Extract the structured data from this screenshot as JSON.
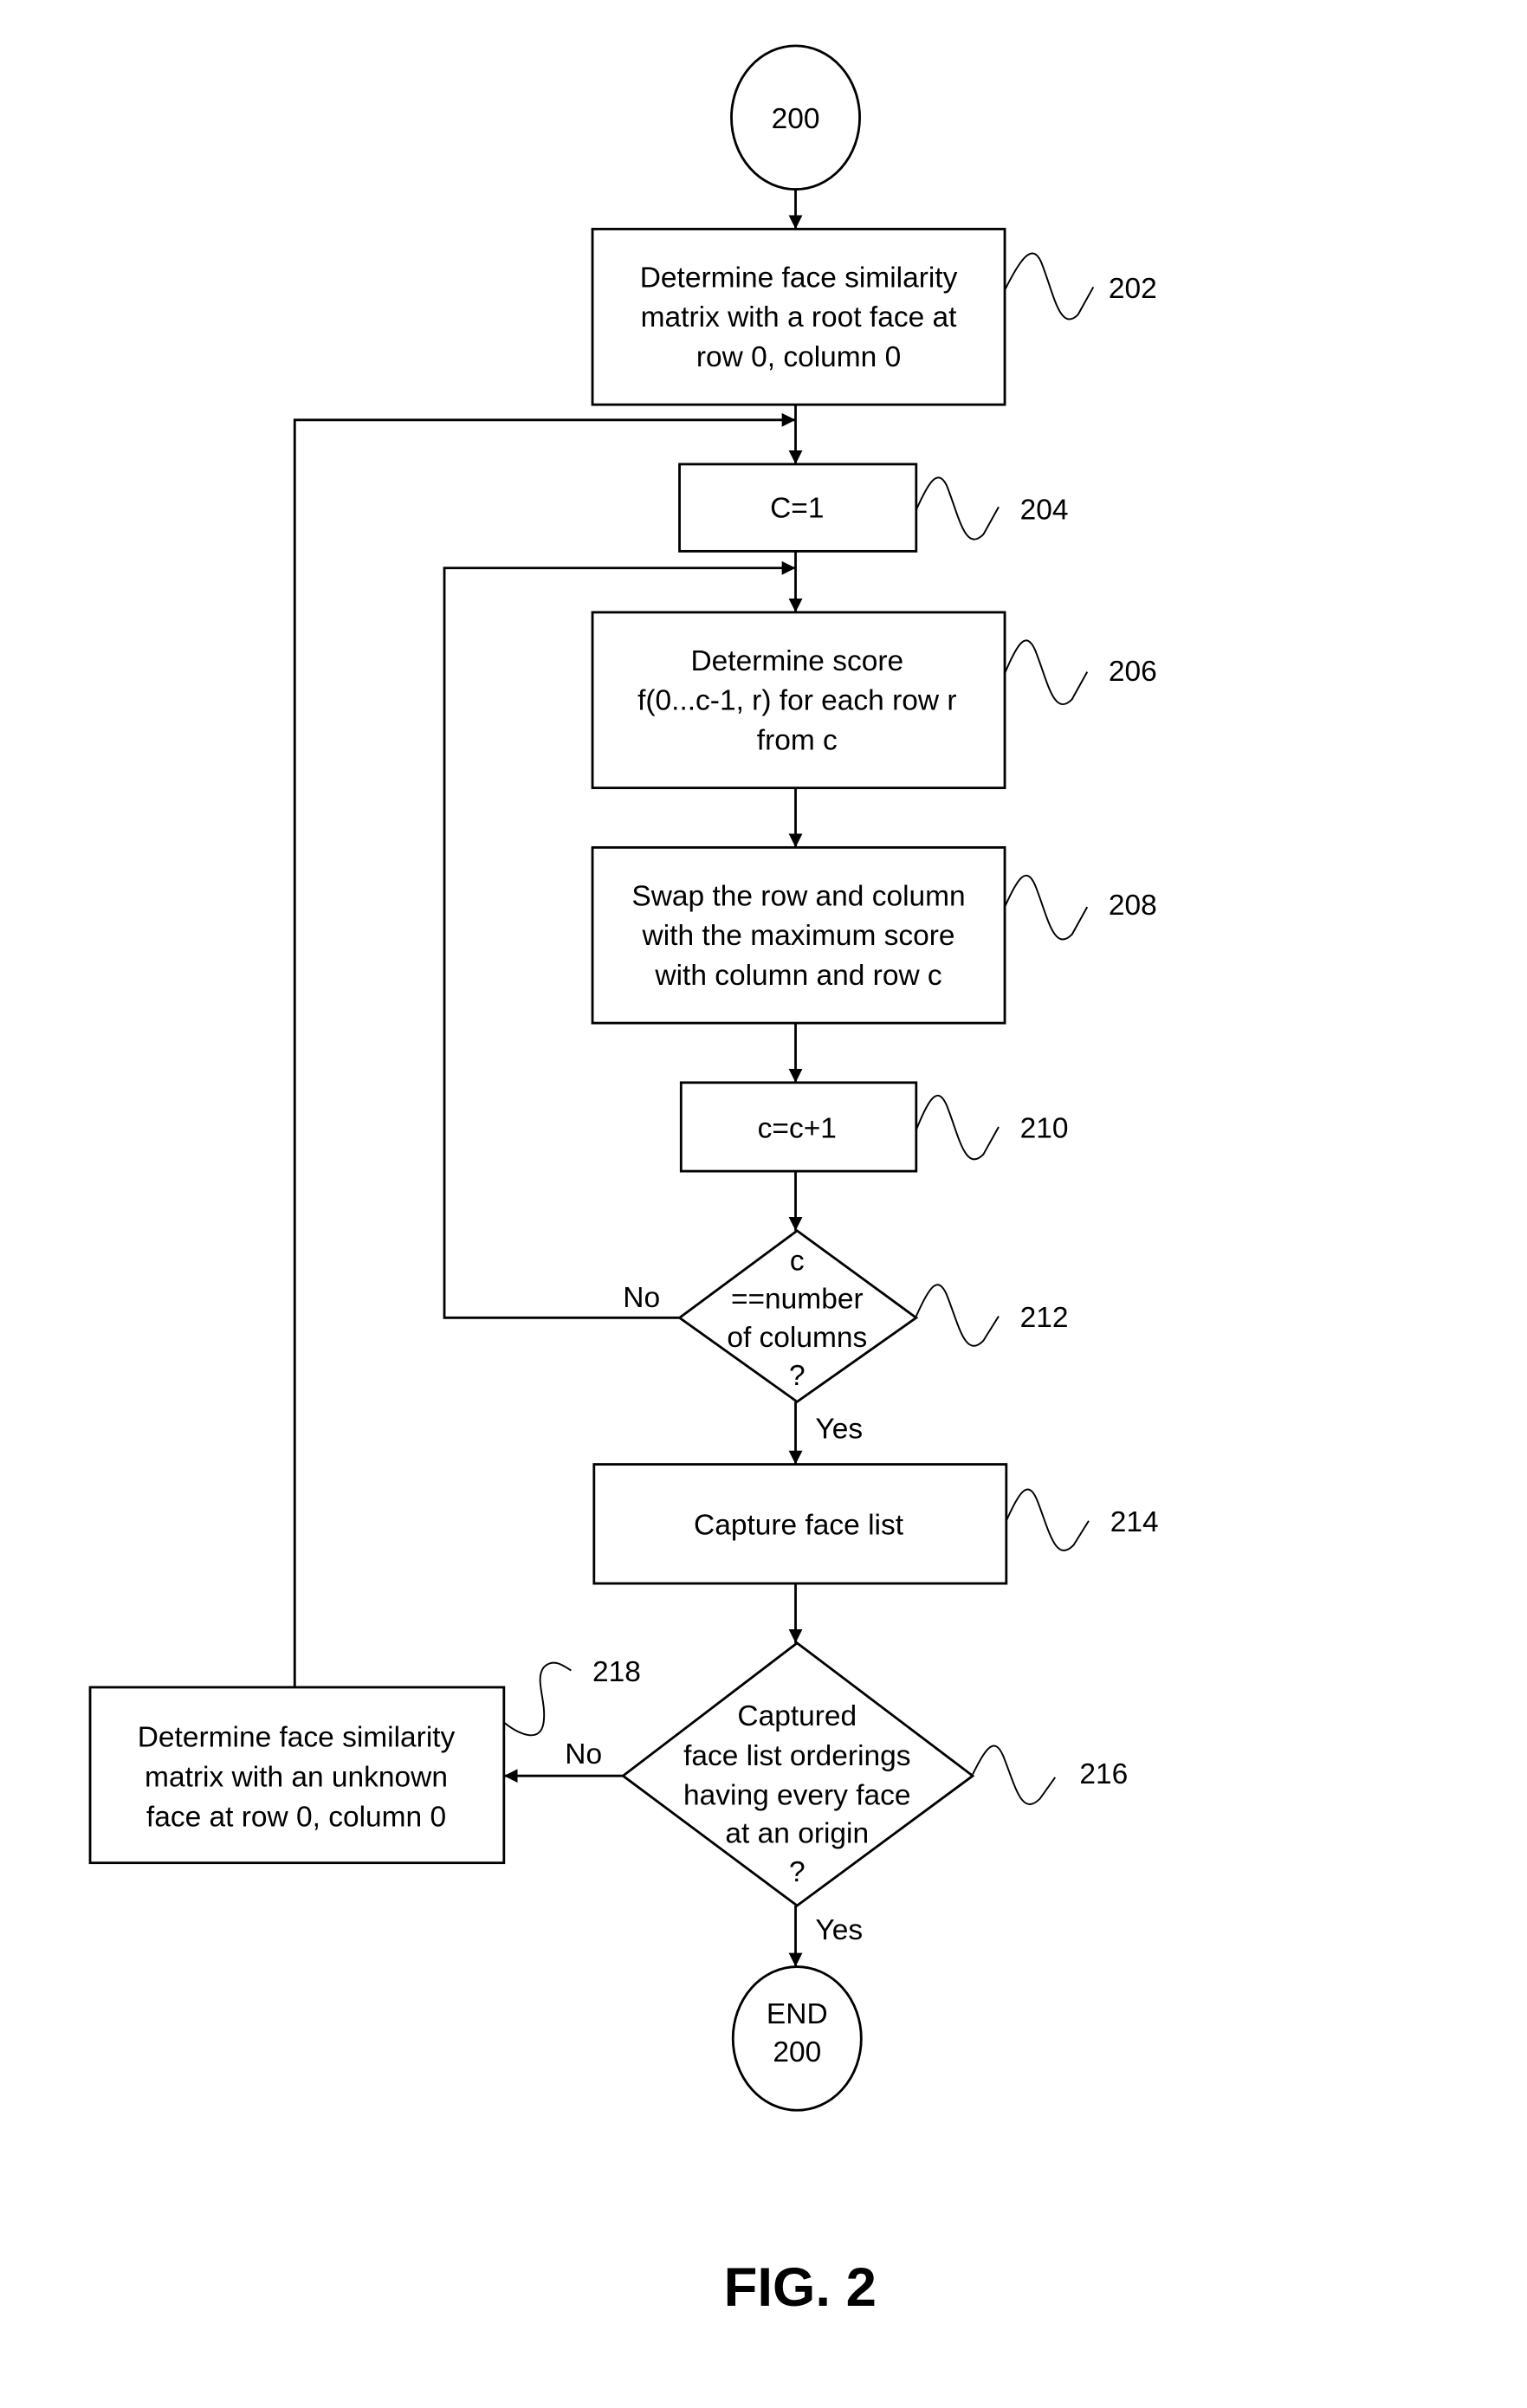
{
  "figure": {
    "caption": "FIG. 2"
  },
  "nodes": {
    "start": {
      "type": "terminal",
      "lines": [
        "200"
      ]
    },
    "n202": {
      "type": "process",
      "ref": "202",
      "lines": [
        "Determine face similarity",
        "matrix with a root face at",
        "row 0, column 0"
      ]
    },
    "n204": {
      "type": "process",
      "ref": "204",
      "lines": [
        "C=1"
      ]
    },
    "n206": {
      "type": "process",
      "ref": "206",
      "lines": [
        "Determine score",
        "f(0...c-1, r) for each row r",
        "from c"
      ]
    },
    "n208": {
      "type": "process",
      "ref": "208",
      "lines": [
        "Swap the row and column",
        "with the maximum score",
        "with column and row c"
      ]
    },
    "n210": {
      "type": "process",
      "ref": "210",
      "lines": [
        "c=c+1"
      ]
    },
    "n212": {
      "type": "decision",
      "ref": "212",
      "lines": [
        "c",
        "==number",
        "of columns",
        "?"
      ]
    },
    "n214": {
      "type": "process",
      "ref": "214",
      "lines": [
        "Capture face list"
      ]
    },
    "n216": {
      "type": "decision",
      "ref": "216",
      "lines": [
        "Captured",
        "face list orderings",
        "having every face",
        "at an origin",
        "?"
      ]
    },
    "n218": {
      "type": "process",
      "ref": "218",
      "lines": [
        "Determine face similarity",
        "matrix with an unknown",
        "face at row 0, column 0"
      ]
    },
    "end": {
      "type": "terminal",
      "lines": [
        "END",
        "200"
      ]
    }
  },
  "edges": {
    "e212_no": {
      "from": "212",
      "to": "206",
      "label": "No"
    },
    "e212_yes": {
      "from": "212",
      "to": "214",
      "label": "Yes"
    },
    "e216_no": {
      "from": "216",
      "to": "218",
      "label": "No"
    },
    "e216_yes": {
      "from": "216",
      "to": "end",
      "label": "Yes"
    },
    "e218_loop": {
      "from": "218",
      "to": "204",
      "label": ""
    }
  }
}
